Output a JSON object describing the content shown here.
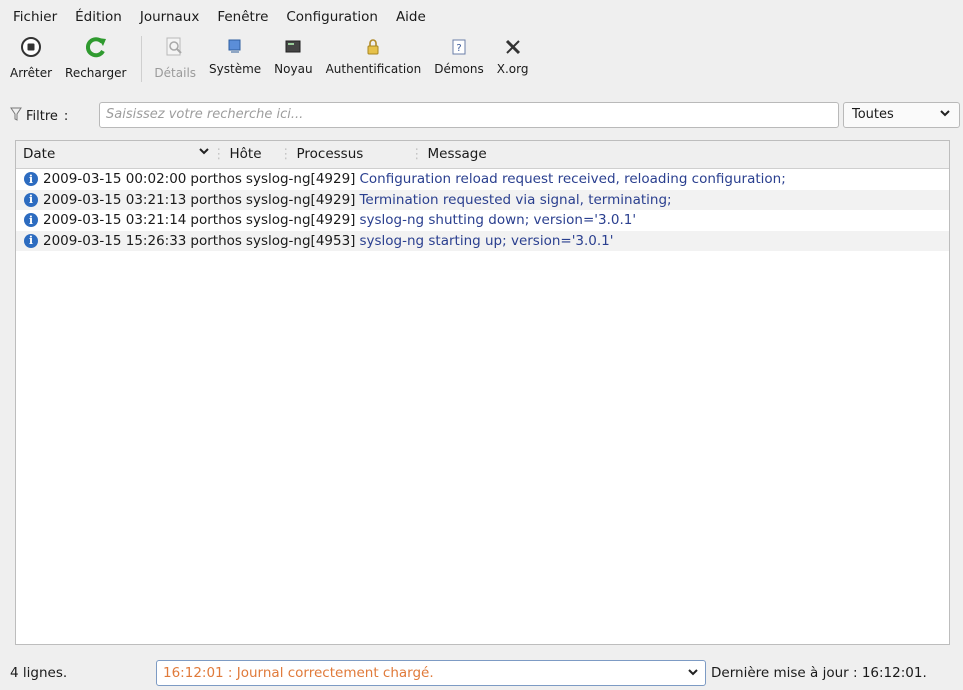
{
  "menubar": {
    "items": [
      "Fichier",
      "Édition",
      "Journaux",
      "Fenêtre",
      "Configuration",
      "Aide"
    ]
  },
  "toolbar": {
    "stop": "Arrêter",
    "reload": "Recharger",
    "details": "Détails",
    "system": "Système",
    "kernel": "Noyau",
    "auth": "Authentification",
    "daemons": "Démons",
    "xorg": "X.org"
  },
  "filter": {
    "label": "Filtre",
    "colon": ":",
    "placeholder": "Saisissez votre recherche ici...",
    "select_value": "Toutes"
  },
  "table": {
    "headers": [
      "Date",
      "Hôte",
      "Processus",
      "Message"
    ],
    "rows": [
      {
        "date": "2009-03-15 00:02:00",
        "host": "porthos",
        "process": "syslog-ng[4929]",
        "message": "Configuration reload request received, reloading configuration;"
      },
      {
        "date": "2009-03-15 03:21:13",
        "host": "porthos",
        "process": "syslog-ng[4929]",
        "message": "Termination requested via signal, terminating;"
      },
      {
        "date": "2009-03-15 03:21:14",
        "host": "porthos",
        "process": "syslog-ng[4929]",
        "message": "syslog-ng shutting down; version='3.0.1'"
      },
      {
        "date": "2009-03-15 15:26:33",
        "host": "porthos",
        "process": "syslog-ng[4953]",
        "message": "syslog-ng starting up; version='3.0.1'"
      }
    ]
  },
  "status": {
    "count": "4 lignes.",
    "message": "16:12:01 : Journal correctement chargé.",
    "updated": "Dernière mise à jour : 16:12:01."
  },
  "colors": {
    "message_text": "#2a3f8f",
    "status_text": "#e07a3a",
    "info_icon": "#2d6cc0"
  }
}
